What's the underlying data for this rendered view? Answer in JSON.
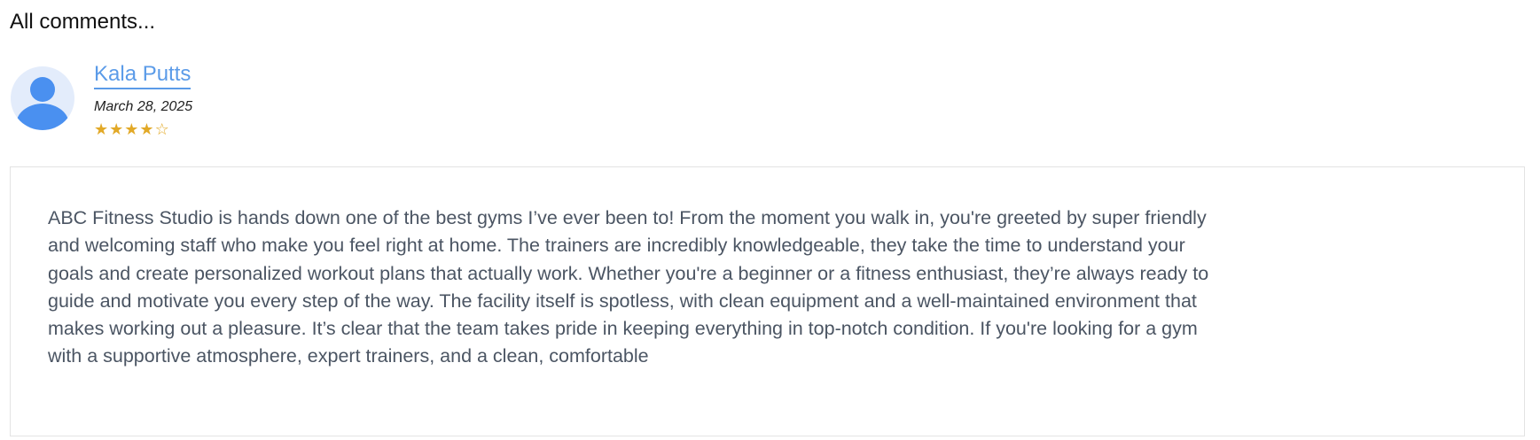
{
  "section": {
    "title": "All comments..."
  },
  "comment": {
    "author": "Kala Putts",
    "date": "March 28, 2025",
    "rating": 4,
    "rating_max": 5,
    "rating_color": "#e2a927",
    "author_link_color": "#5b9be8",
    "avatar_icon": "user-avatar-icon",
    "body": "ABC Fitness Studio is hands down one of the best gyms I’ve ever been to! From the moment you walk in, you're greeted by super friendly and welcoming staff who make you feel right at home. The trainers are incredibly knowledgeable, they take the time to understand your goals and create personalized workout plans that actually work. Whether you're a beginner or a fitness enthusiast, they’re always ready to guide and motivate you every step of the way. The facility itself is spotless, with clean equipment and a well-maintained environment that makes working out a pleasure. It’s clear that the team takes pride in keeping everything in top-notch condition. If you're looking for a gym with a supportive atmosphere, expert trainers, and a clean, comfortable"
  }
}
